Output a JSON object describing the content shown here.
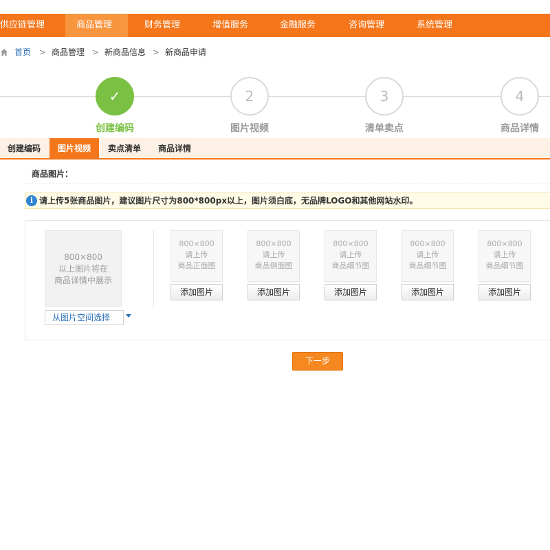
{
  "topnav": {
    "items": [
      {
        "label": "供应链管理",
        "active": false
      },
      {
        "label": "商品管理",
        "active": true
      },
      {
        "label": "财务管理",
        "active": false
      },
      {
        "label": "增值服务",
        "active": false
      },
      {
        "label": "金融服务",
        "active": false
      },
      {
        "label": "咨询管理",
        "active": false
      },
      {
        "label": "系统管理",
        "active": false
      }
    ]
  },
  "breadcrumb": {
    "home": "首页",
    "separator": ">",
    "items": [
      "商品管理",
      "新商品信息",
      "新商品申请"
    ]
  },
  "steps": [
    {
      "number": "✓",
      "label": "创建编码",
      "status": "done"
    },
    {
      "number": "2",
      "label": "图片视频",
      "status": "pending"
    },
    {
      "number": "3",
      "label": "清单卖点",
      "status": "pending"
    },
    {
      "number": "4",
      "label": "商品详情",
      "status": "pending"
    }
  ],
  "subtabs": [
    {
      "label": "创建编码",
      "active": false
    },
    {
      "label": "图片视频",
      "active": true
    },
    {
      "label": "卖点清单",
      "active": false
    },
    {
      "label": "商品详情",
      "active": false
    }
  ],
  "section": {
    "title": "商品图片："
  },
  "notice": {
    "icon": "info-icon",
    "text": "请上传5张商品图片，建议图片尺寸为800*800px以上，图片须白底，无品牌LOGO和其他网站水印。"
  },
  "upload": {
    "main_preview": {
      "line1": "800×800",
      "line2": "以上图片将在",
      "line3": "商品详情中展示"
    },
    "space_select": "从图片空间选择",
    "slots": [
      {
        "size": "800×800",
        "hint1": "请上传",
        "hint2": "商品正面图",
        "button": "添加图片"
      },
      {
        "size": "800×800",
        "hint1": "请上传",
        "hint2": "商品侧面图",
        "button": "添加图片"
      },
      {
        "size": "800×800",
        "hint1": "请上传",
        "hint2": "商品细节图",
        "button": "添加图片"
      },
      {
        "size": "800×800",
        "hint1": "请上传",
        "hint2": "商品细节图",
        "button": "添加图片"
      },
      {
        "size": "800×800",
        "hint1": "请上传",
        "hint2": "商品细节图",
        "button": "添加图片"
      }
    ]
  },
  "actions": {
    "next": "下一步"
  },
  "colors": {
    "brand_orange": "#f5761a",
    "success_green": "#7ac143",
    "link_blue": "#2a6eb5"
  }
}
